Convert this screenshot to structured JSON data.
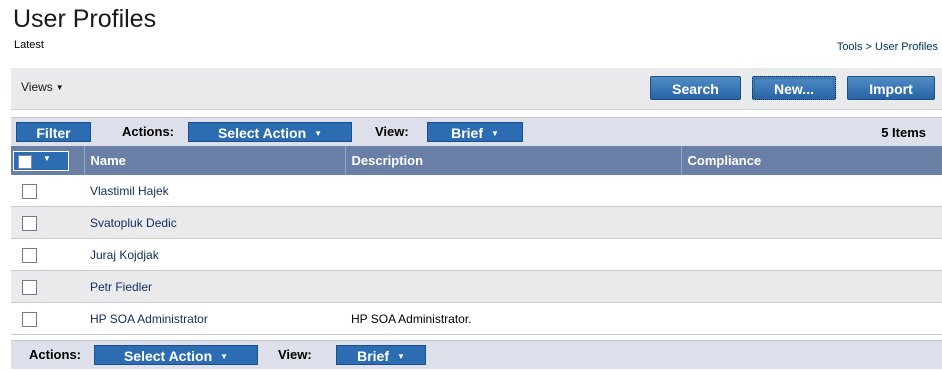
{
  "header": {
    "title": "User Profiles",
    "subtitle": "Latest",
    "breadcrumb": "Tools > User Profiles"
  },
  "toolbar": {
    "views_label": "Views",
    "search_label": "Search",
    "new_label": "New...",
    "import_label": "Import"
  },
  "filterbar": {
    "filter_label": "Filter",
    "actions_label": "Actions:",
    "actions_select": "Select Action",
    "view_label": "View:",
    "view_select": "Brief",
    "items_count": "5 Items"
  },
  "table": {
    "columns": [
      "Name",
      "Description",
      "Compliance"
    ],
    "rows": [
      {
        "name": "Vlastimil Hajek",
        "description": "",
        "compliance": ""
      },
      {
        "name": "Svatopluk Dedic",
        "description": "",
        "compliance": ""
      },
      {
        "name": "Juraj Kojdjak",
        "description": "",
        "compliance": ""
      },
      {
        "name": "Petr Fiedler",
        "description": "",
        "compliance": ""
      },
      {
        "name": "HP SOA Administrator",
        "description": "HP SOA Administrator.",
        "compliance": ""
      }
    ]
  },
  "bottombar": {
    "actions_label": "Actions:",
    "actions_select": "Select Action",
    "view_label": "View:",
    "view_select": "Brief"
  },
  "colors": {
    "button_blue": "#2b6cb2",
    "header_row": "#6a7fa6",
    "bar_bg": "#dde0ea",
    "toolbar_bg": "#e9eaec",
    "alt_row": "#eaeaec"
  }
}
